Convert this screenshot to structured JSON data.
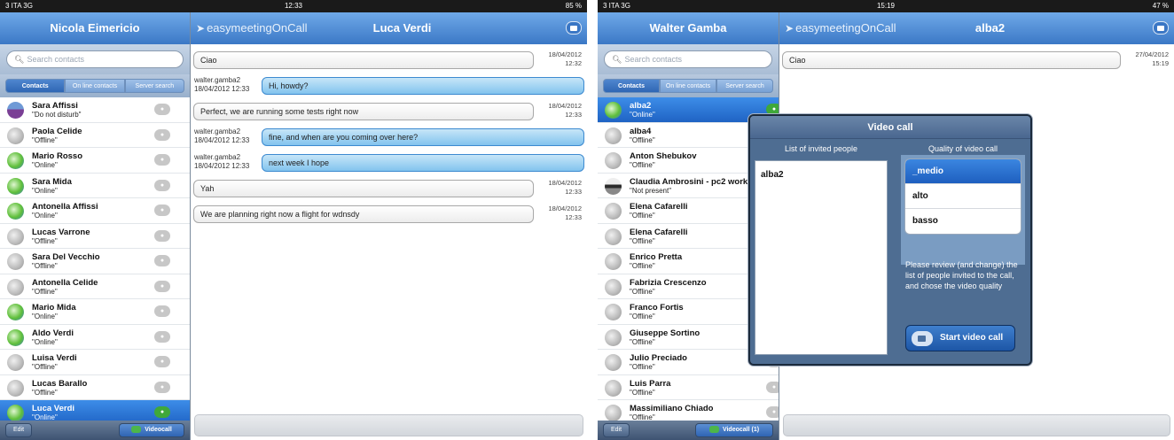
{
  "left": {
    "status": {
      "carrier": "3 ITA  3G",
      "time": "12:33",
      "battery": "85 %"
    },
    "sidebar": {
      "title": "Nicola Eimericio",
      "search_placeholder": "Search contacts",
      "tabs": [
        "Contacts",
        "On line contacts",
        "Server search"
      ],
      "contacts": [
        {
          "name": "Sara Affissi",
          "status": "\"Do not disturb\"",
          "presence": "dnd"
        },
        {
          "name": "Paola Celide",
          "status": "\"Offline\"",
          "presence": "offline"
        },
        {
          "name": "Mario Rosso",
          "status": "\"Online\"",
          "presence": "online"
        },
        {
          "name": "Sara Mida",
          "status": "\"Online\"",
          "presence": "online"
        },
        {
          "name": "Antonella Affissi",
          "status": "\"Online\"",
          "presence": "online"
        },
        {
          "name": "Lucas Varrone",
          "status": "\"Offline\"",
          "presence": "offline"
        },
        {
          "name": "Sara Del Vecchio",
          "status": "\"Offline\"",
          "presence": "offline"
        },
        {
          "name": "Antonella Celide",
          "status": "\"Offline\"",
          "presence": "offline"
        },
        {
          "name": "Mario Mida",
          "status": "\"Online\"",
          "presence": "online"
        },
        {
          "name": "Aldo Verdi",
          "status": "\"Online\"",
          "presence": "online"
        },
        {
          "name": "Luisa Verdi",
          "status": "\"Offline\"",
          "presence": "offline"
        },
        {
          "name": "Lucas Barallo",
          "status": "\"Offline\"",
          "presence": "offline"
        },
        {
          "name": "Luca Verdi",
          "status": "\"Online\"",
          "presence": "online",
          "selected": true
        }
      ],
      "edit_label": "Edit",
      "videocall_label": "Videocall"
    },
    "main": {
      "brand": "easymeetingOnCall",
      "title": "Luca Verdi",
      "messages": [
        {
          "dir": "in",
          "text": "Ciao",
          "time": "18/04/2012 12:32"
        },
        {
          "dir": "out",
          "sender": "walter.gamba2",
          "date": "18/04/2012 12:33",
          "text": "Hi, howdy?"
        },
        {
          "dir": "in",
          "text": "Perfect, we are running some tests right now",
          "time": "18/04/2012 12:33"
        },
        {
          "dir": "out",
          "sender": "walter.gamba2",
          "date": "18/04/2012 12:33",
          "text": "fine, and when are you coming over here?"
        },
        {
          "dir": "out",
          "sender": "walter.gamba2",
          "date": "18/04/2012 12:33",
          "text": "next week I hope"
        },
        {
          "dir": "in",
          "text": "Yah",
          "time": "18/04/2012 12:33"
        },
        {
          "dir": "in",
          "text": "We are planning right now a flight for wdnsdy",
          "time": "18/04/2012 12:33"
        }
      ]
    }
  },
  "right": {
    "status": {
      "carrier": "3 ITA  3G",
      "time": "15:19",
      "battery": "47 %"
    },
    "sidebar": {
      "title": "Walter Gamba",
      "search_placeholder": "Search contacts",
      "tabs": [
        "Contacts",
        "On line contacts",
        "Server search"
      ],
      "contacts": [
        {
          "name": "alba2",
          "status": "\"Online\"",
          "presence": "online",
          "selected": true
        },
        {
          "name": "alba4",
          "status": "\"Offline\"",
          "presence": "offline"
        },
        {
          "name": "Anton Shebukov",
          "status": "\"Offline\"",
          "presence": "offline"
        },
        {
          "name": "Claudia Ambrosini  - pc2 work",
          "status": "\"Not present\"",
          "presence": "away"
        },
        {
          "name": "Elena Cafarelli",
          "status": "\"Offline\"",
          "presence": "offline"
        },
        {
          "name": "Elena Cafarelli",
          "status": "\"Offline\"",
          "presence": "offline"
        },
        {
          "name": "Enrico Pretta",
          "status": "\"Offline\"",
          "presence": "offline"
        },
        {
          "name": "Fabrizia Crescenzo",
          "status": "\"Offline\"",
          "presence": "offline"
        },
        {
          "name": "Franco Fortis",
          "status": "\"Offline\"",
          "presence": "offline"
        },
        {
          "name": "Giuseppe Sortino",
          "status": "\"Offline\"",
          "presence": "offline"
        },
        {
          "name": "Julio Preciado",
          "status": "\"Offline\"",
          "presence": "offline"
        },
        {
          "name": "Luis Parra",
          "status": "\"Offline\"",
          "presence": "offline"
        },
        {
          "name": "Massimiliano Chiado",
          "status": "\"Offline\"",
          "presence": "offline"
        }
      ],
      "edit_label": "Edit",
      "videocall_label": "Videocall (1)"
    },
    "main": {
      "brand": "easymeetingOnCall",
      "title": "alba2",
      "messages": [
        {
          "dir": "in",
          "text": "Ciao",
          "time": "27/04/2012 15:19"
        }
      ]
    },
    "modal": {
      "title": "Video call",
      "invited_title": "List of invited people",
      "quality_title": "Quality of video call",
      "invited": [
        "alba2"
      ],
      "quality_options": [
        "_medio",
        "alto",
        "basso"
      ],
      "quality_selected": "_medio",
      "hint": "Please review (and change) the list of people invited to the call, and chose the video quality",
      "start_label": "Start video call"
    }
  }
}
